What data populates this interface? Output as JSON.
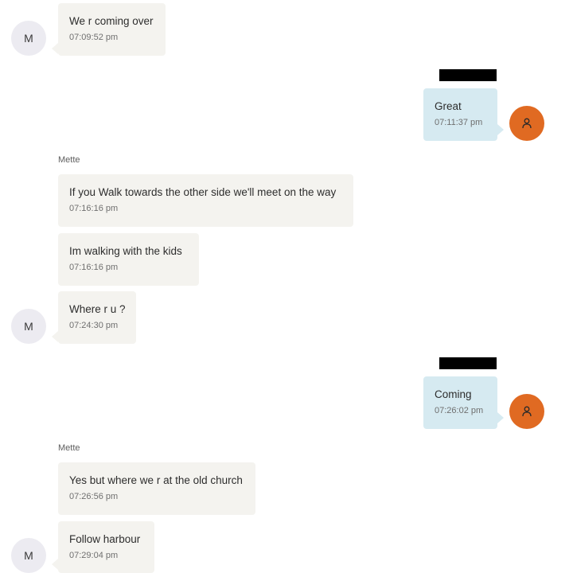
{
  "colors": {
    "incoming_bubble": "#f4f3ef",
    "outgoing_bubble": "#d6eaf1",
    "user_avatar": "#e06a22",
    "contact_avatar": "#ecebf1",
    "redaction": "#000000"
  },
  "contact": {
    "name": "Mette",
    "initial": "M"
  },
  "user": {
    "avatar_icon": "person-icon"
  },
  "messages": [
    {
      "direction": "incoming",
      "text": "We r coming over",
      "time": "07:09:52 pm"
    },
    {
      "direction": "outgoing",
      "text": "Great",
      "time": "07:11:37 pm"
    },
    {
      "direction": "incoming",
      "text": "If you Walk towards the other side we'll meet on the way",
      "time": "07:16:16 pm"
    },
    {
      "direction": "incoming",
      "text": "Im walking with the kids",
      "time": "07:16:16 pm"
    },
    {
      "direction": "incoming",
      "text": "Where r u ?",
      "time": "07:24:30 pm"
    },
    {
      "direction": "outgoing",
      "text": "Coming",
      "time": "07:26:02 pm"
    },
    {
      "direction": "incoming",
      "text": "Yes but where we r at the old church",
      "time": "07:26:56 pm"
    },
    {
      "direction": "incoming",
      "text": "Follow harbour",
      "time": "07:29:04 pm"
    }
  ]
}
